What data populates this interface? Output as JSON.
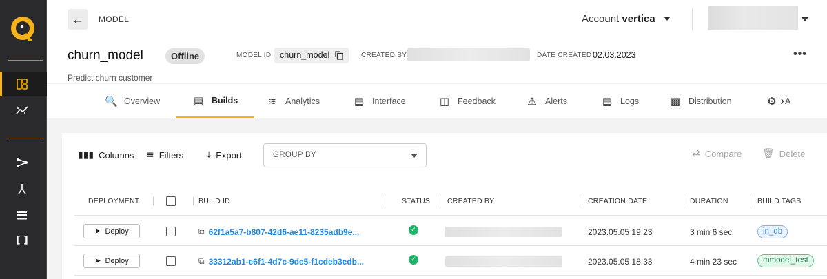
{
  "header": {
    "breadcrumb": "MODEL",
    "account_label": "Account",
    "account_name": "vertica"
  },
  "model": {
    "name": "churn_model",
    "status": "Offline",
    "model_id_label": "MODEL ID",
    "model_id": "churn_model",
    "created_by_label": "CREATED BY",
    "date_created_label": "DATE CREATED",
    "date_created": "02.03.2023",
    "description": "Predict churn customer"
  },
  "tabs": [
    {
      "label": "Overview",
      "icon": "overview-icon"
    },
    {
      "label": "Builds",
      "icon": "builds-icon",
      "active": true
    },
    {
      "label": "Analytics",
      "icon": "analytics-icon"
    },
    {
      "label": "Interface",
      "icon": "interface-icon"
    },
    {
      "label": "Feedback",
      "icon": "feedback-icon"
    },
    {
      "label": "Alerts",
      "icon": "alerts-icon"
    },
    {
      "label": "Logs",
      "icon": "logs-icon"
    },
    {
      "label": "Distribution",
      "icon": "distribution-icon"
    },
    {
      "label": "A",
      "icon": "automation-icon"
    }
  ],
  "toolbar": {
    "columns": "Columns",
    "filters": "Filters",
    "export": "Export",
    "group_by": "GROUP BY",
    "compare": "Compare",
    "delete": "Delete"
  },
  "table": {
    "headers": {
      "deployment": "DEPLOYMENT",
      "build_id": "BUILD ID",
      "status": "STATUS",
      "created_by": "CREATED BY",
      "creation_date": "CREATION DATE",
      "duration": "DURATION",
      "build_tags": "BUILD TAGS"
    },
    "rows": [
      {
        "deploy": "Deploy",
        "build_id": "62f1a5a7-b807-42d6-ae11-8235adb9e...",
        "status": "success",
        "creation_date": "2023.05.05 19:23",
        "duration": "3 min 6 sec",
        "tag": "in_db",
        "tag_color": "#3f88cf"
      },
      {
        "deploy": "Deploy",
        "build_id": "33312ab1-e6f1-4d7c-9de5-f1cdeb3edb...",
        "status": "success",
        "creation_date": "2023.05.05 18:33",
        "duration": "4 min 23 sec",
        "tag": "mmodel_test",
        "tag_color": "#187d45"
      }
    ]
  },
  "colors": {
    "accent": "#f6b21a",
    "link": "#1e88e5",
    "success": "#21b36b"
  }
}
